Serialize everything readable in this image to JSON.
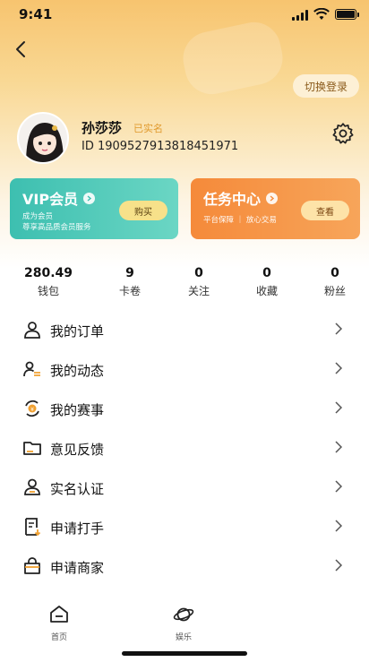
{
  "status_bar": {
    "time": "9:41"
  },
  "header": {
    "switch_login": "切换登录"
  },
  "user": {
    "name": "孙莎莎",
    "verified": "已实名",
    "id_text": "ID 1909527913818451971"
  },
  "cards": {
    "vip": {
      "title": "VIP会员",
      "sub1": "成为会员",
      "sub2": "尊享高品质会员服务",
      "button": "购买"
    },
    "task": {
      "title": "任务中心",
      "sub1": "平台保障 ｜ 放心交易",
      "button": "查看"
    }
  },
  "stats": [
    {
      "value": "280.49",
      "label": "钱包"
    },
    {
      "value": "9",
      "label": "卡卷"
    },
    {
      "value": "0",
      "label": "关注"
    },
    {
      "value": "0",
      "label": "收藏"
    },
    {
      "value": "0",
      "label": "粉丝"
    }
  ],
  "menu": [
    {
      "label": "我的订单",
      "icon": "user-icon"
    },
    {
      "label": "我的动态",
      "icon": "user-list-icon"
    },
    {
      "label": "我的赛事",
      "icon": "event-coin-icon"
    },
    {
      "label": "意见反馈",
      "icon": "folder-icon"
    },
    {
      "label": "实名认证",
      "icon": "id-person-icon"
    },
    {
      "label": "申请打手",
      "icon": "form-icon"
    },
    {
      "label": "申请商家",
      "icon": "shop-bag-icon"
    }
  ],
  "tabbar": [
    {
      "label": "首页",
      "icon": "home-icon"
    },
    {
      "label": "娱乐",
      "icon": "planet-icon"
    }
  ],
  "colors": {
    "accent_orange": "#f58a3a",
    "accent_teal": "#3dbfb0",
    "header_gold": "#f7c46f"
  }
}
